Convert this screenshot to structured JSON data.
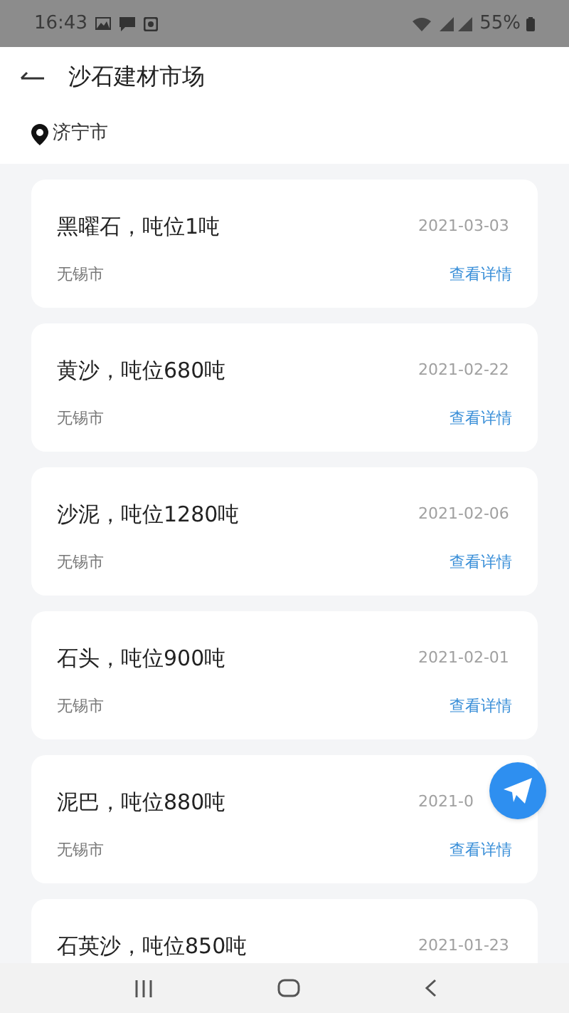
{
  "status_bar": {
    "time": "16:43",
    "battery": "55%"
  },
  "header": {
    "title": "沙石建材市场",
    "location": "济宁市"
  },
  "listings": [
    {
      "title": "黑曜石，吨位1吨",
      "date": "2021-03-03",
      "city": "无锡市",
      "link": "查看详情"
    },
    {
      "title": "黄沙，吨位680吨",
      "date": "2021-02-22",
      "city": "无锡市",
      "link": "查看详情"
    },
    {
      "title": "沙泥，吨位1280吨",
      "date": "2021-02-06",
      "city": "无锡市",
      "link": "查看详情"
    },
    {
      "title": "石头，吨位900吨",
      "date": "2021-02-01",
      "city": "无锡市",
      "link": "查看详情"
    },
    {
      "title": "泥巴，吨位880吨",
      "date": "2021-0",
      "city": "无锡市",
      "link": "查看详情"
    },
    {
      "title": "石英沙，吨位850吨",
      "date": "2021-01-23"
    }
  ]
}
